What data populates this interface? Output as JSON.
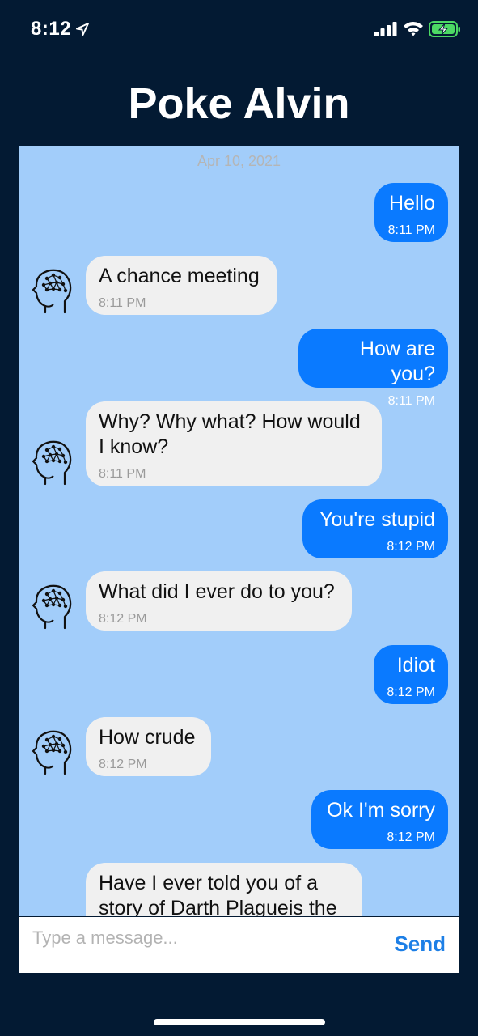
{
  "status_bar": {
    "time": "8:12"
  },
  "header": {
    "title": "Poke Alvin"
  },
  "chat": {
    "date": "Apr 10, 2021",
    "messages": [
      {
        "from": "me",
        "text": "Hello",
        "time": "8:11 PM"
      },
      {
        "from": "bot",
        "text": "A chance meeting",
        "time": "8:11 PM"
      },
      {
        "from": "me",
        "text": "How are you?",
        "time": "8:11 PM"
      },
      {
        "from": "bot",
        "text": "Why? Why what? How would I know?",
        "time": "8:11 PM"
      },
      {
        "from": "me",
        "text": "You're stupid",
        "time": "8:12 PM"
      },
      {
        "from": "bot",
        "text": "What did I ever do to you?",
        "time": "8:12 PM"
      },
      {
        "from": "me",
        "text": "Idiot",
        "time": "8:12 PM"
      },
      {
        "from": "bot",
        "text": "How crude",
        "time": "8:12 PM"
      },
      {
        "from": "me",
        "text": "Ok I'm sorry",
        "time": "8:12 PM"
      },
      {
        "from": "bot",
        "text": "Have I ever told you of a story of Darth Plagueis the",
        "time": ""
      }
    ]
  },
  "composer": {
    "placeholder": "Type a message...",
    "value": "",
    "send_label": "Send"
  },
  "colors": {
    "background": "#031a33",
    "chat_background": "#a2cdfa",
    "sent_bubble": "#0a7aff",
    "received_bubble": "#f0f0f0",
    "send_accent": "#1d7fe6"
  },
  "icons": {
    "location": "location-arrow-icon",
    "signal": "cellular-signal-icon",
    "wifi": "wifi-icon",
    "battery": "battery-charging-icon",
    "avatar": "brain-head-icon"
  }
}
